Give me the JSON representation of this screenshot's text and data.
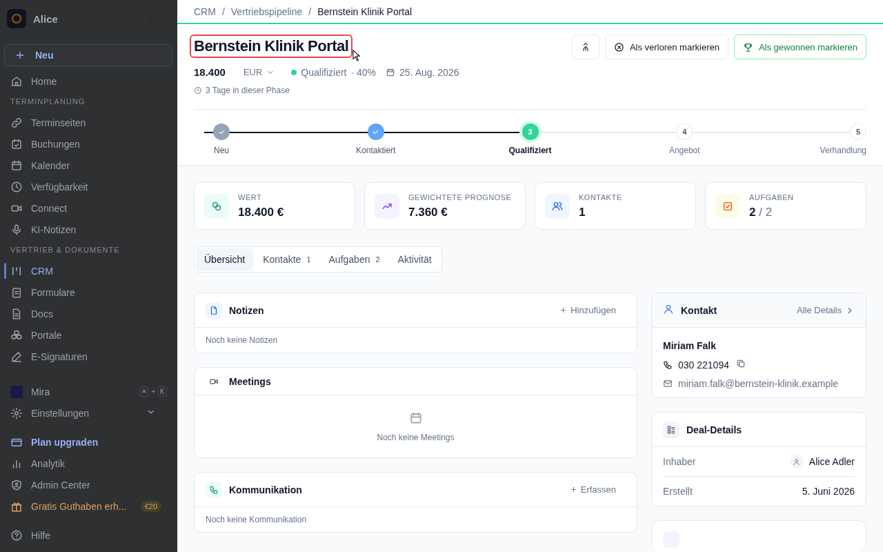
{
  "sidebar": {
    "workspace": "Alice",
    "new_button": "Neu",
    "items": [
      {
        "kind": "item",
        "label": "Home",
        "selected": false
      },
      {
        "kind": "section",
        "label": "TERMINPLANUNG"
      },
      {
        "kind": "item",
        "label": "Terminseiten",
        "selected": false
      },
      {
        "kind": "item",
        "label": "Buchungen",
        "selected": false
      },
      {
        "kind": "item",
        "label": "Kalender",
        "selected": false
      },
      {
        "kind": "item",
        "label": "Verfügbarkeit",
        "selected": false
      },
      {
        "kind": "item",
        "label": "Connect",
        "selected": false
      },
      {
        "kind": "item",
        "label": "KI-Notizen",
        "selected": false
      },
      {
        "kind": "section",
        "label": "VERTRIEB & DOKUMENTE"
      },
      {
        "kind": "item",
        "label": "CRM",
        "selected": true
      },
      {
        "kind": "item",
        "label": "Formulare",
        "selected": false
      },
      {
        "kind": "item",
        "label": "Docs",
        "selected": false
      },
      {
        "kind": "item",
        "label": "Portale",
        "selected": false
      },
      {
        "kind": "item",
        "label": "E-Signaturen",
        "selected": false
      }
    ],
    "assistant": {
      "label": "Mira",
      "keys": [
        "⌘",
        "+",
        "K"
      ]
    },
    "settings": {
      "label": "Einstellungen",
      "expanded": false
    },
    "footer": [
      {
        "kind": "upgrade",
        "label": "Plan upgraden"
      },
      {
        "kind": "item",
        "label": "Analytik"
      },
      {
        "kind": "item",
        "label": "Admin Center"
      },
      {
        "kind": "promo",
        "label": "Gratis Guthaben erh...",
        "badge": "€20"
      }
    ],
    "help": "Hilfe"
  },
  "breadcrumb": {
    "separator": "/",
    "items": [
      "CRM",
      "Vertriebspipeline",
      "Bernstein Klinik Portal"
    ]
  },
  "deal": {
    "title": "Bernstein Klinik Portal",
    "highlighted": true,
    "amount": "18.400",
    "currency": "EUR",
    "phase": "Qualifiziert",
    "probability": "· 40%",
    "date": "25. Aug. 2026",
    "in_phase": "3 Tage in dieser Phase",
    "buttons": [
      {
        "kind": "icon"
      },
      {
        "kind": "lost",
        "label": "Als verloren markieren"
      },
      {
        "kind": "won",
        "label": "Als gewonnen markieren"
      }
    ]
  },
  "stepper": [
    {
      "label": "Neu",
      "completed": true,
      "selected": false,
      "color": "#94a3b8"
    },
    {
      "label": "Kontaktiert",
      "completed": true,
      "selected": false,
      "color": "#60a5fa"
    },
    {
      "number": "3",
      "label": "Qualifiziert",
      "completed": false,
      "selected": true,
      "color": "#34d399"
    },
    {
      "number": "4",
      "label": "Angebot",
      "completed": false,
      "selected": false
    },
    {
      "number": "5",
      "label": "Verhandlung",
      "completed": false,
      "selected": false
    }
  ],
  "stats": [
    {
      "label": "WERT",
      "value": "18.400 €",
      "color": "#ecfdf5"
    },
    {
      "label": "GEWICHTETE PROGNOSE",
      "value": "7.360 €",
      "color": "#f5f3ff"
    },
    {
      "label": "KONTAKTE",
      "value": "1",
      "color": "#eff6ff"
    },
    {
      "label": "AUFGABEN",
      "value": "2",
      "total": "/ 2",
      "color": "#fefce8"
    }
  ],
  "tabs": [
    {
      "label": "Übersicht",
      "selected": true
    },
    {
      "label": "Kontakte",
      "count": "1",
      "selected": false
    },
    {
      "label": "Aufgaben",
      "count": "2",
      "selected": false
    },
    {
      "label": "Aktivität",
      "selected": false
    }
  ],
  "panels": [
    {
      "kind": "notes",
      "title": "Notizen",
      "action": "Hinzufügen",
      "empty": "Noch keine Notizen"
    },
    {
      "kind": "meetings",
      "title": "Meetings",
      "empty": "Noch keine Meetings"
    },
    {
      "kind": "communication",
      "title": "Kommunikation",
      "action": "Erfassen",
      "empty": "Noch keine Kommunikation"
    }
  ],
  "contact": {
    "title": "Kontakt",
    "link": "Alle Details",
    "name": "Miriam Falk",
    "phone": "030 221094",
    "email": "miriam.falk@bernstein-klinik.example"
  },
  "deal_details": {
    "title": "Deal-Details",
    "rows": [
      {
        "label": "Inhaber",
        "value": "Alice Adler",
        "avatar": true
      },
      {
        "label": "Erstellt",
        "value": "5. Juni 2026",
        "avatar": false
      }
    ]
  }
}
